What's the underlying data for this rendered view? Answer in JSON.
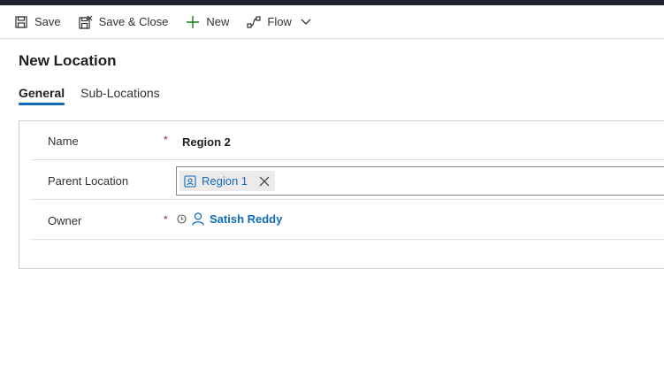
{
  "toolbar": {
    "save_label": "Save",
    "save_close_label": "Save & Close",
    "new_label": "New",
    "flow_label": "Flow"
  },
  "page": {
    "title": "New Location"
  },
  "tabs": [
    {
      "label": "General",
      "active": true
    },
    {
      "label": "Sub-Locations",
      "active": false
    }
  ],
  "form": {
    "name": {
      "label": "Name",
      "required": "*",
      "value": "Region 2"
    },
    "parent_location": {
      "label": "Parent Location",
      "value": "Region 1"
    },
    "owner": {
      "label": "Owner",
      "required": "*",
      "value": "Satish Reddy"
    }
  },
  "colors": {
    "accent": "#0f6cbd",
    "required": "#a4262c",
    "topbar": "#1f2230"
  },
  "icons": {
    "save": "save-icon",
    "save_close": "save-close-icon",
    "new": "plus-icon",
    "flow": "flow-icon",
    "flow_dropdown": "chevron-down-icon",
    "lookup_entity": "location-entity-icon",
    "lookup_remove": "close-icon",
    "owner_lock": "lock-icon",
    "owner_person": "person-icon"
  }
}
